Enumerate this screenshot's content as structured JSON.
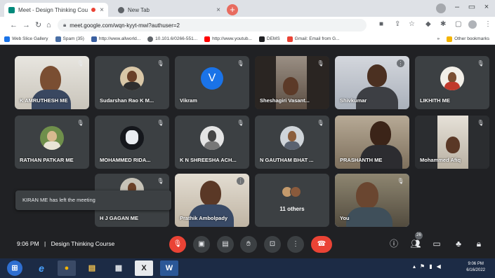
{
  "browser": {
    "tabs": [
      {
        "title": "Meet - Design Thinking Cou",
        "favicon": "meet-icon",
        "recording": true,
        "active": true
      },
      {
        "title": "New Tab",
        "favicon": "chrome-icon",
        "active": false
      }
    ],
    "url": "meet.google.com/wqn-kyyt-mwi?authuser=2",
    "bookmarks": [
      {
        "label": "Web Slice Gallery",
        "icon": "web-slice-icon",
        "color": "#1a73e8"
      },
      {
        "label": "Spam (35)",
        "icon": "mail-icon",
        "color": "#4a6fa5"
      },
      {
        "label": "http://www.allworld...",
        "icon": "page-icon",
        "color": "#3a5fa0"
      },
      {
        "label": "10.101.6/0266-551...",
        "icon": "globe-icon",
        "color": "#5f6368"
      },
      {
        "label": "http://www.youtub...",
        "icon": "youtube-icon",
        "color": "#ff0000"
      },
      {
        "label": "DEMS",
        "icon": "dems-icon",
        "color": "#202124"
      },
      {
        "label": "Gmail: Email from G...",
        "icon": "gmail-icon",
        "color": "#ea4335"
      },
      {
        "label": "»",
        "icon": "",
        "color": ""
      },
      {
        "label": "Other bookmarks",
        "icon": "folder-icon",
        "color": "#f4b400"
      }
    ]
  },
  "participants": [
    {
      "name": "K AMRUTHESH ME",
      "kind": "video",
      "muted": true
    },
    {
      "name": "Sudarshan Rao K M...",
      "kind": "avatar",
      "muted": true
    },
    {
      "name": "Vikram",
      "kind": "letter",
      "letter": "V",
      "color": "#1a73e8",
      "muted": true
    },
    {
      "name": "Sheshagiri Vasant...",
      "kind": "video",
      "muted": true
    },
    {
      "name": "Shivkumar",
      "kind": "video",
      "muted": true
    },
    {
      "name": "LIKHITH ME",
      "kind": "avatar",
      "muted": true
    },
    {
      "name": "RATHAN PATKAR ME",
      "kind": "avatar",
      "muted": true
    },
    {
      "name": "MOHAMMED RIDA...",
      "kind": "avatar",
      "muted": true
    },
    {
      "name": "K N SHREESHA ACH...",
      "kind": "avatar",
      "muted": true
    },
    {
      "name": "N GAUTHAM BHAT ...",
      "kind": "avatar",
      "muted": true
    },
    {
      "name": "PRASHANTH ME",
      "kind": "video",
      "muted": false
    },
    {
      "name": "Mohammed Afiq",
      "kind": "video",
      "muted": true
    },
    {
      "name": "H J GAGAN ME",
      "kind": "avatar",
      "muted": true
    },
    {
      "name": "Prathik Ambolpady",
      "kind": "video",
      "muted": true
    },
    {
      "name": "11 others",
      "kind": "others",
      "muted": false
    },
    {
      "name": "You",
      "kind": "video",
      "muted": true,
      "highlight": true
    }
  ],
  "toast": "KIRAN ME has left the meeting",
  "meeting": {
    "time": "9:06 PM",
    "separator": "|",
    "title": "Design Thinking Course",
    "people_count": "26"
  },
  "taskbar": {
    "apps": [
      {
        "name": "start-button",
        "glyph": "⊞"
      },
      {
        "name": "internet-explorer-icon",
        "glyph": "e"
      },
      {
        "name": "chrome-icon",
        "glyph": "●"
      },
      {
        "name": "file-explorer-icon",
        "glyph": "▤"
      },
      {
        "name": "calculator-icon",
        "glyph": "▦"
      },
      {
        "name": "excel-icon",
        "glyph": "X"
      },
      {
        "name": "word-icon",
        "glyph": "W"
      }
    ],
    "time": "9:06 PM",
    "date": "6/16/2022"
  },
  "colors": {
    "accent": "#8ab4f8",
    "end_call": "#ea4335",
    "tile": "#3c4043"
  }
}
